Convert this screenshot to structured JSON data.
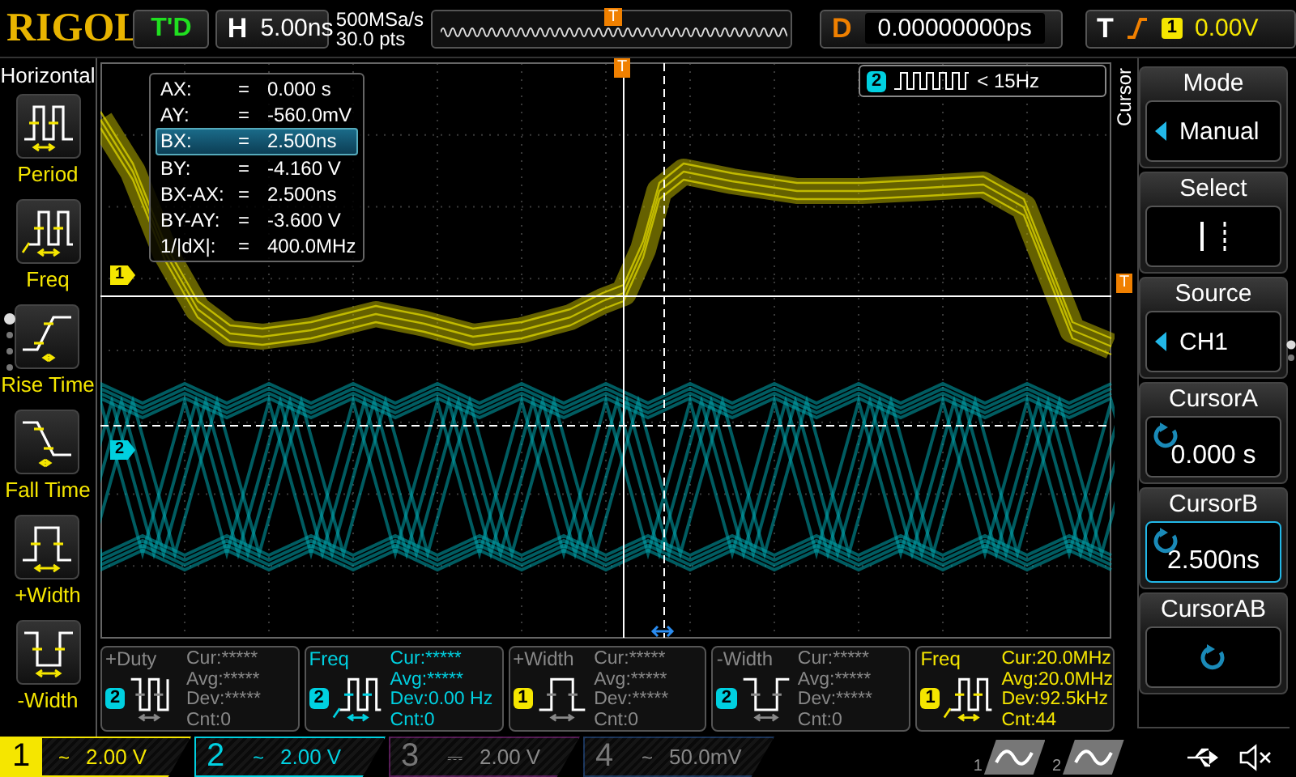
{
  "top_bar": {
    "brand": "RIGOL",
    "run_status": "T'D",
    "timebase": {
      "label": "H",
      "value": "5.00ns"
    },
    "sample_rate": "500MSa/s",
    "memory_depth": "30.0 pts",
    "overview_marker": "T",
    "delay": {
      "label": "D",
      "value": "0.00000000ps"
    },
    "trigger": {
      "label": "T",
      "rising_edge": true,
      "source": "1",
      "level": "0.00V"
    }
  },
  "left_menu": {
    "title": "Horizontal",
    "items": [
      {
        "kind": "period",
        "label": "Period"
      },
      {
        "kind": "freq",
        "label": "Freq"
      },
      {
        "kind": "rise",
        "label": "Rise Time"
      },
      {
        "kind": "fall",
        "label": "Fall Time"
      },
      {
        "kind": "pwidth",
        "label": "+Width"
      },
      {
        "kind": "nwidth",
        "label": "-Width"
      }
    ]
  },
  "screen": {
    "trigger_marker": "T",
    "level_marker": "T",
    "channel_markers": [
      {
        "label": "1"
      },
      {
        "label": "2"
      }
    ],
    "cursor_readout": [
      {
        "label": "AX:",
        "eq": "=",
        "value": "0.000 s",
        "selected": false
      },
      {
        "label": "AY:",
        "eq": "=",
        "value": "-560.0mV",
        "selected": false
      },
      {
        "label": "BX:",
        "eq": "=",
        "value": "2.500ns",
        "selected": true
      },
      {
        "label": "BY:",
        "eq": "=",
        "value": "-4.160 V",
        "selected": false
      },
      {
        "label": "BX-AX:",
        "eq": "=",
        "value": "2.500ns",
        "selected": false
      },
      {
        "label": "BY-AY:",
        "eq": "=",
        "value": "-3.600 V",
        "selected": false
      },
      {
        "label": "1/|dX|:",
        "eq": "=",
        "value": "400.0MHz",
        "selected": false
      }
    ],
    "counter": {
      "channel": "2",
      "value": "< 15Hz"
    }
  },
  "right_menu": {
    "title": "Cursor",
    "items": [
      {
        "kind": "select",
        "title": "Mode",
        "value": "Manual",
        "selected": false
      },
      {
        "kind": "cursor-pair",
        "title": "Select",
        "selected": false
      },
      {
        "kind": "select",
        "title": "Source",
        "value": "CH1",
        "selected": false
      },
      {
        "kind": "knob",
        "title": "CursorA",
        "value": "0.000 s",
        "selected": false
      },
      {
        "kind": "knob",
        "title": "CursorB",
        "value": "2.500ns",
        "selected": true
      },
      {
        "kind": "knob",
        "title": "CursorAB",
        "selected": false
      }
    ]
  },
  "measurements": [
    {
      "name": "+Duty",
      "kind": "duty",
      "channel": "2",
      "active": false,
      "stats": [
        "Cur:*****",
        "Avg:*****",
        "Dev:*****",
        "Cnt:0"
      ]
    },
    {
      "name": "Freq",
      "kind": "freq",
      "channel": "2",
      "active": true,
      "stats": [
        "Cur:*****",
        "Avg:*****",
        "Dev:0.00 Hz",
        "Cnt:0"
      ]
    },
    {
      "name": "+Width",
      "kind": "pwidth",
      "channel": "1",
      "active": false,
      "stats": [
        "Cur:*****",
        "Avg:*****",
        "Dev:*****",
        "Cnt:0"
      ]
    },
    {
      "name": "-Width",
      "kind": "nwidth",
      "channel": "2",
      "active": false,
      "stats": [
        "Cur:*****",
        "Avg:*****",
        "Dev:*****",
        "Cnt:0"
      ]
    },
    {
      "name": "Freq",
      "kind": "freq",
      "channel": "1",
      "active": true,
      "stats": [
        "Cur:20.0MHz",
        "Avg:20.0MHz",
        "Dev:92.5kHz",
        "Cnt:44"
      ]
    }
  ],
  "channels": [
    {
      "number": "1",
      "coupling": "~",
      "scale": "2.00 V",
      "enabled": true,
      "selected": true
    },
    {
      "number": "2",
      "coupling": "~",
      "scale": "2.00 V",
      "enabled": true,
      "selected": false
    },
    {
      "number": "3",
      "coupling": "⎓",
      "scale": "2.00 V",
      "enabled": false,
      "selected": false
    },
    {
      "number": "4",
      "coupling": "~",
      "scale": "50.0mV",
      "enabled": false,
      "selected": false
    }
  ],
  "math_slots": [
    {
      "label": "1"
    },
    {
      "label": "2"
    }
  ]
}
